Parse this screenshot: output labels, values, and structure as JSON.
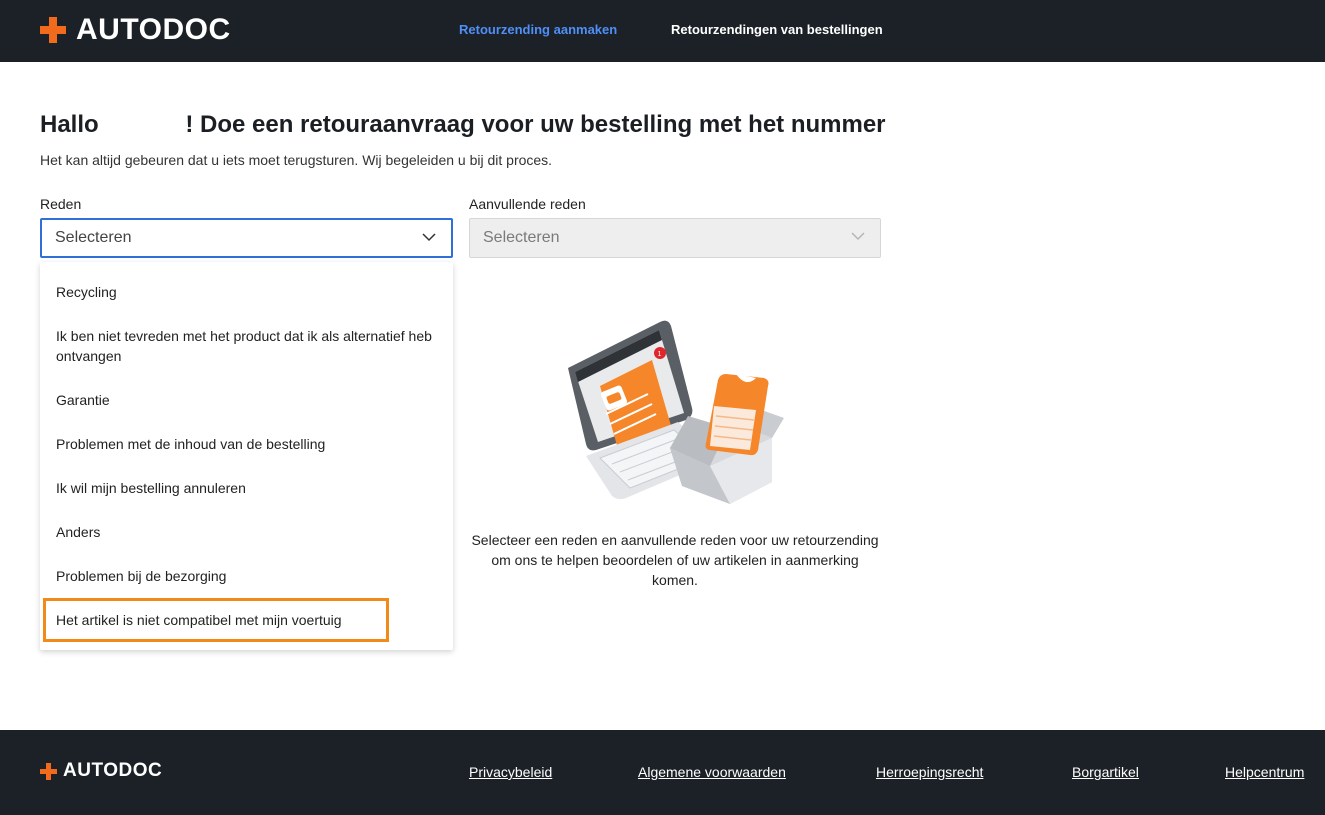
{
  "header": {
    "logo_text": "AUTODOC",
    "nav": [
      {
        "label": "Retourzending aanmaken",
        "active": true
      },
      {
        "label": "Retourzendingen van bestellingen",
        "active": false
      }
    ]
  },
  "main": {
    "title": "Hallo             ! Doe een retouraanvraag voor uw bestelling met het nummer",
    "subtitle": "Het kan altijd gebeuren dat u iets moet terugsturen. Wij begeleiden u bij dit proces.",
    "reason": {
      "label": "Reden",
      "placeholder": "Selecteren",
      "open": true,
      "options": [
        "Recycling",
        "Ik ben niet tevreden met het product dat ik als alternatief heb ontvangen",
        "Garantie",
        "Problemen met de inhoud van de bestelling",
        "Ik wil mijn bestelling annuleren",
        "Anders",
        "Problemen bij de bezorging",
        "Het artikel is niet compatibel met mijn voertuig"
      ],
      "highlighted_option": "Het artikel is niet compatibel met mijn voertuig"
    },
    "additional_reason": {
      "label": "Aanvullende reden",
      "placeholder": "Selecteren",
      "disabled": true
    },
    "empty_state": {
      "illustration": "laptop-and-parcel-illustration",
      "notification_count": "1",
      "text": "Selecteer een reden en aanvullende reden voor uw retourzending om ons te helpen beoordelen of uw artikelen in aanmerking komen."
    }
  },
  "footer": {
    "logo_text": "AUTODOC",
    "links": [
      "Privacybeleid",
      "Algemene voorwaarden",
      "Herroepingsrecht",
      "Borgartikel",
      "Helpcentrum"
    ]
  },
  "colors": {
    "header_bg": "#1b2127",
    "brand_orange": "#f26b1d",
    "active_link": "#4f8ff7",
    "focus_border": "#2f6fd6",
    "highlight_border": "#f28a1a"
  }
}
